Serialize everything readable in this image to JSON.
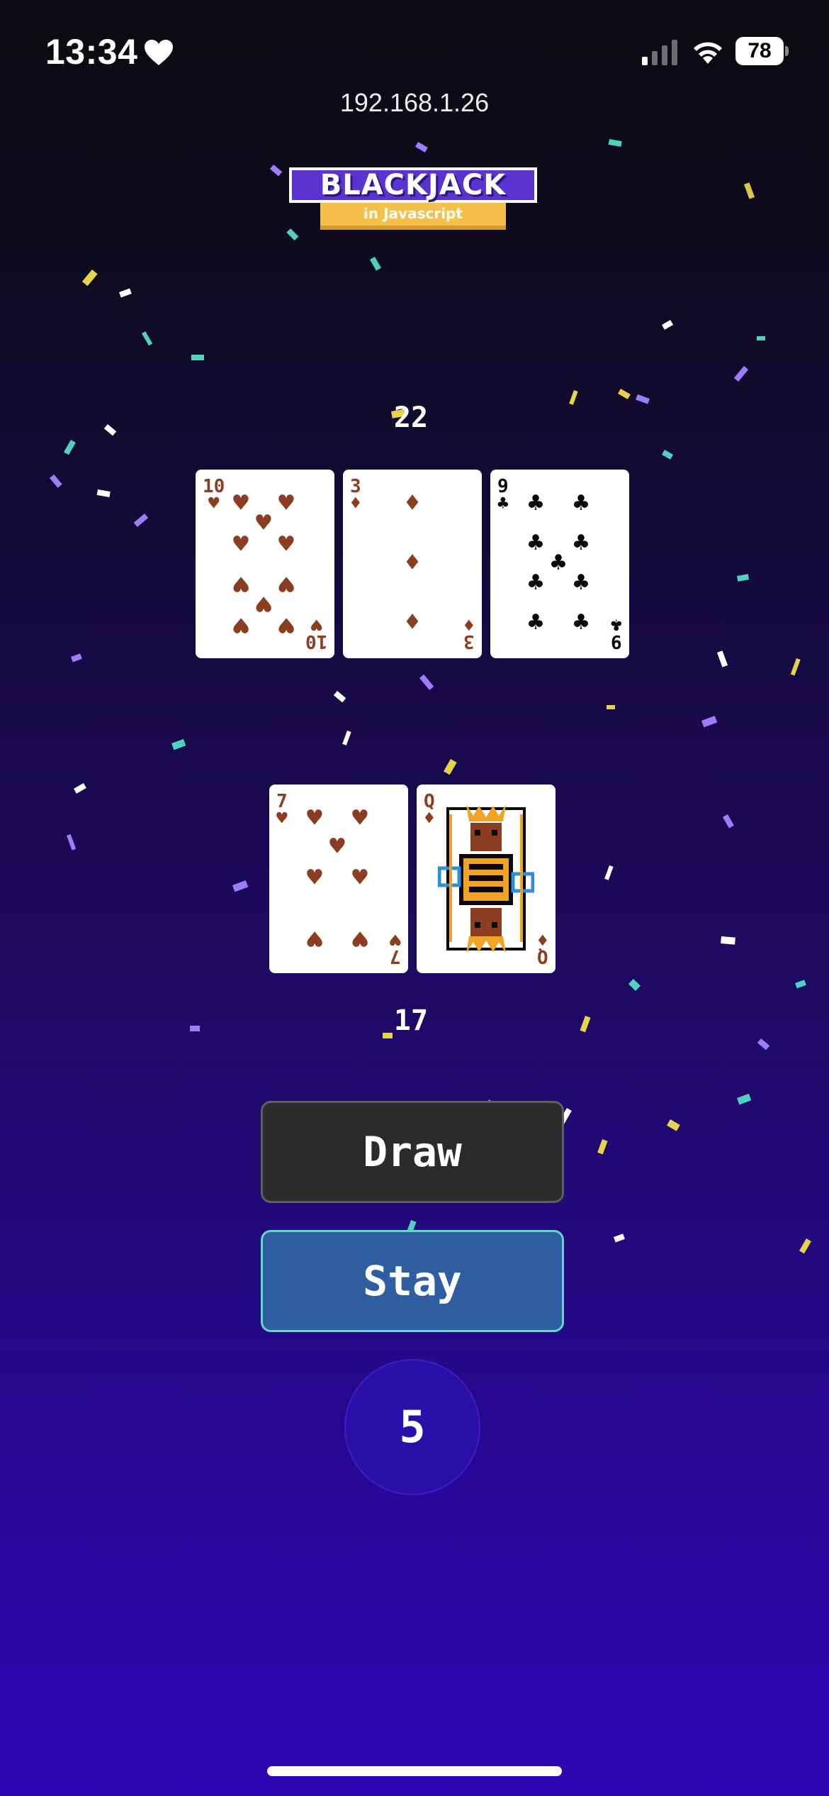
{
  "status_bar": {
    "time": "13:34",
    "battery": "78"
  },
  "browser": {
    "url": "192.168.1.26"
  },
  "logo": {
    "title": "BLACKJACK",
    "subtitle": "in Javascript"
  },
  "dealer": {
    "score": "22",
    "cards": [
      {
        "rank": "10",
        "suit": "hearts",
        "suit_glyph": "♥"
      },
      {
        "rank": "3",
        "suit": "diamonds",
        "suit_glyph": "♦"
      },
      {
        "rank": "9",
        "suit": "clubs",
        "suit_glyph": "♣"
      }
    ]
  },
  "player": {
    "score": "17",
    "cards": [
      {
        "rank": "7",
        "suit": "hearts",
        "suit_glyph": "♥"
      },
      {
        "rank": "Q",
        "suit": "diamonds",
        "suit_glyph": "♦"
      }
    ]
  },
  "actions": {
    "draw_label": "Draw",
    "stay_label": "Stay"
  },
  "counter": {
    "value": "5"
  },
  "colors": {
    "red_suit": "#8b3d22",
    "black_suit": "#0a0a0a",
    "draw_button": "#2b2b2b",
    "stay_button": "#2f5ea0",
    "stay_border": "#62d6c8",
    "logo_purple": "#5b33d0",
    "logo_gold": "#f4c04a"
  }
}
